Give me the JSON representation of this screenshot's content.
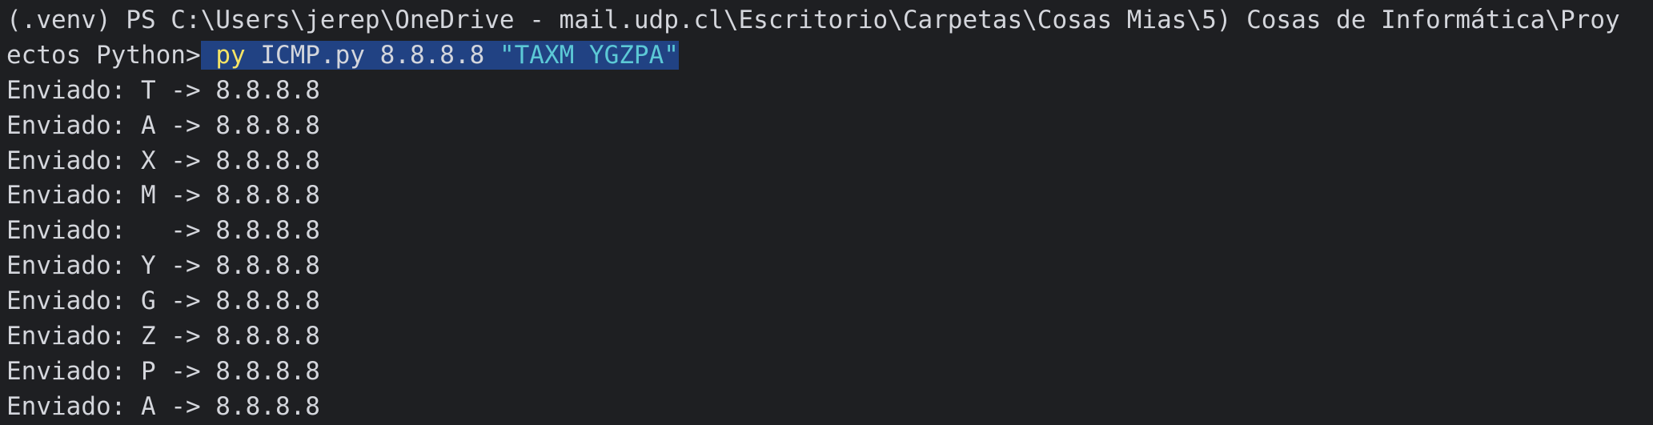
{
  "terminal": {
    "prompt_line1": "(.venv) PS C:\\Users\\jerep\\OneDrive - mail.udp.cl\\Escritorio\\Carpetas\\Cosas Mias\\5) Cosas de Informática\\Proy",
    "prompt_line2": "ectos Python>",
    "command": {
      "executable": "py",
      "args": "ICMP.py 8.8.8.8",
      "string_arg": "\"TAXM YGZPA\""
    },
    "output": [
      "Enviado: T -> 8.8.8.8",
      "Enviado: A -> 8.8.8.8",
      "Enviado: X -> 8.8.8.8",
      "Enviado: M -> 8.8.8.8",
      "Enviado:   -> 8.8.8.8",
      "Enviado: Y -> 8.8.8.8",
      "Enviado: G -> 8.8.8.8",
      "Enviado: Z -> 8.8.8.8",
      "Enviado: P -> 8.8.8.8",
      "Enviado: A -> 8.8.8.8"
    ],
    "colors": {
      "background": "#1e1f22",
      "text": "#d4d6dc",
      "command": "#f5e465",
      "string": "#5cc9d6",
      "selection": "#214283"
    }
  }
}
